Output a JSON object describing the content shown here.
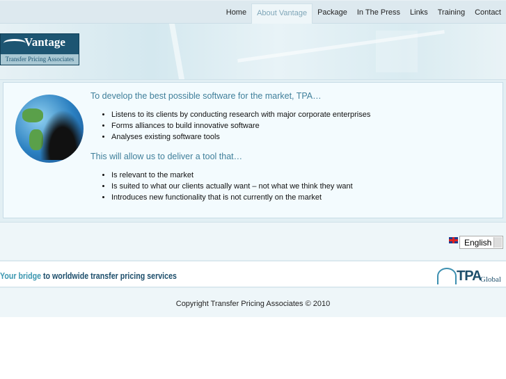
{
  "nav": {
    "items": [
      "Home",
      "About Vantage",
      "Package",
      "In The Press",
      "Links",
      "Training",
      "Contact"
    ],
    "active": "About Vantage"
  },
  "logo": {
    "name": "Vantage",
    "subtitle": "Transfer Pricing Associates"
  },
  "content": {
    "heading1": "To develop the best possible software for the market, TPA…",
    "list1": [
      "Listens to its clients by conducting research with major corporate enterprises",
      "Forms alliances to build innovative software",
      "Analyses existing software tools"
    ],
    "heading2": "This will allow us to deliver a tool that…",
    "list2": [
      "Is relevant to the market",
      "Is suited to what our clients actually want – not what we think they want",
      "Introduces new functionality that is not currently on the market"
    ]
  },
  "language": {
    "selected": "English"
  },
  "tagline": {
    "part1": "Your bridge",
    "part2": " to worldwide transfer pricing services"
  },
  "tpa_logo": {
    "name": "TPA",
    "suffix": "Global"
  },
  "footer": {
    "copyright": "Copyright Transfer Pricing Associates © 2010"
  },
  "colors": {
    "accent": "#3f7f9a",
    "nav_bg": "#dde9ef",
    "navy": "#1d5572"
  }
}
